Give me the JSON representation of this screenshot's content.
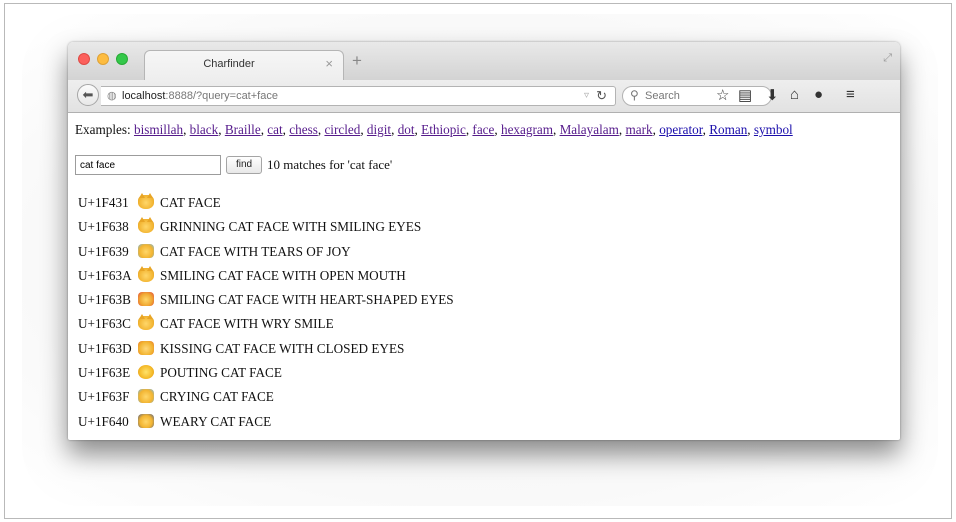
{
  "browser": {
    "tab_title": "Charfinder",
    "tab_close": "×",
    "new_tab": "+",
    "url_host": "localhost",
    "url_rest": ":8888/?query=cat+face",
    "search_placeholder": "Search",
    "icons": [
      "back-icon",
      "globe-icon",
      "dropdown-icon",
      "reload-icon",
      "search-icon",
      "bookmark-star-icon",
      "reading-list-icon",
      "download-icon",
      "home-icon",
      "chat-icon",
      "menu-icon"
    ]
  },
  "page": {
    "examples_label": "Examples:",
    "examples": [
      {
        "label": "bismillah",
        "visited": true
      },
      {
        "label": "black",
        "visited": true
      },
      {
        "label": "Braille",
        "visited": true
      },
      {
        "label": "cat",
        "visited": true
      },
      {
        "label": "chess",
        "visited": true
      },
      {
        "label": "circled",
        "visited": true
      },
      {
        "label": "digit",
        "visited": true
      },
      {
        "label": "dot",
        "visited": true
      },
      {
        "label": "Ethiopic",
        "visited": true
      },
      {
        "label": "face",
        "visited": true
      },
      {
        "label": "hexagram",
        "visited": true
      },
      {
        "label": "Malayalam",
        "visited": true
      },
      {
        "label": "mark",
        "visited": true
      },
      {
        "label": "operator",
        "visited": false
      },
      {
        "label": "Roman",
        "visited": false
      },
      {
        "label": "symbol",
        "visited": false
      }
    ],
    "query_value": "cat face",
    "find_label": "find",
    "match_summary": "10 matches for 'cat face'",
    "results": [
      {
        "code": "U+1F431",
        "name": "CAT FACE",
        "glyph": "cat-face-emoji"
      },
      {
        "code": "U+1F638",
        "name": "GRINNING CAT FACE WITH SMILING EYES",
        "glyph": "grinning-cat-emoji"
      },
      {
        "code": "U+1F639",
        "name": "CAT FACE WITH TEARS OF JOY",
        "glyph": "joy-cat-emoji"
      },
      {
        "code": "U+1F63A",
        "name": "SMILING CAT FACE WITH OPEN MOUTH",
        "glyph": "smiley-cat-emoji"
      },
      {
        "code": "U+1F63B",
        "name": "SMILING CAT FACE WITH HEART-SHAPED EYES",
        "glyph": "heart-eyes-cat-emoji"
      },
      {
        "code": "U+1F63C",
        "name": "CAT FACE WITH WRY SMILE",
        "glyph": "smirk-cat-emoji"
      },
      {
        "code": "U+1F63D",
        "name": "KISSING CAT FACE WITH CLOSED EYES",
        "glyph": "kissing-cat-emoji"
      },
      {
        "code": "U+1F63E",
        "name": "POUTING CAT FACE",
        "glyph": "pouting-cat-emoji"
      },
      {
        "code": "U+1F63F",
        "name": "CRYING CAT FACE",
        "glyph": "crying-cat-emoji"
      },
      {
        "code": "U+1F640",
        "name": "WEARY CAT FACE",
        "glyph": "weary-cat-emoji"
      }
    ]
  },
  "colors": {
    "link": "#1a0dab",
    "visited_link": "#551a8b",
    "close_button": "#fc605c",
    "minimize_button": "#fdbc40",
    "maximize_button": "#34c84a"
  }
}
